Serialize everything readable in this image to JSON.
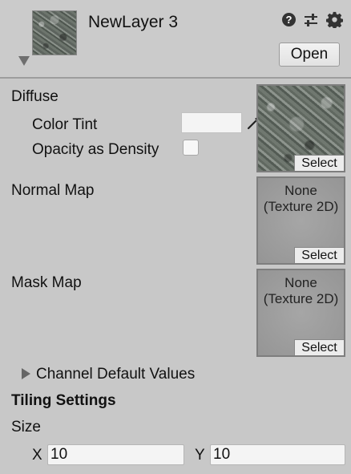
{
  "header": {
    "layer_name": "NewLayer 3",
    "help_icon": "help-icon",
    "help_glyph": "?",
    "preset_icon": "preset-sliders-icon",
    "gear_icon": "gear-icon",
    "open_label": "Open"
  },
  "diffuse": {
    "section_label": "Diffuse",
    "color_tint_label": "Color Tint",
    "color_tint_value": "#f4f4f4",
    "opacity_label": "Opacity as Densitу",
    "opacity_checked": false,
    "select_label": "Select"
  },
  "normal_map": {
    "label": "Normal Map",
    "none_line1": "None",
    "none_line2": "(Texture 2D)",
    "select_label": "Select"
  },
  "mask_map": {
    "label": "Mask Map",
    "none_line1": "None",
    "none_line2": "(Texture 2D)",
    "select_label": "Select"
  },
  "channel_defaults": {
    "label": "Channel Default Values",
    "expanded": false
  },
  "tiling": {
    "section_label": "Tiling Settings",
    "size_label": "Size",
    "x_label": "X",
    "x_value": "10",
    "y_label": "Y",
    "y_value": "10"
  }
}
